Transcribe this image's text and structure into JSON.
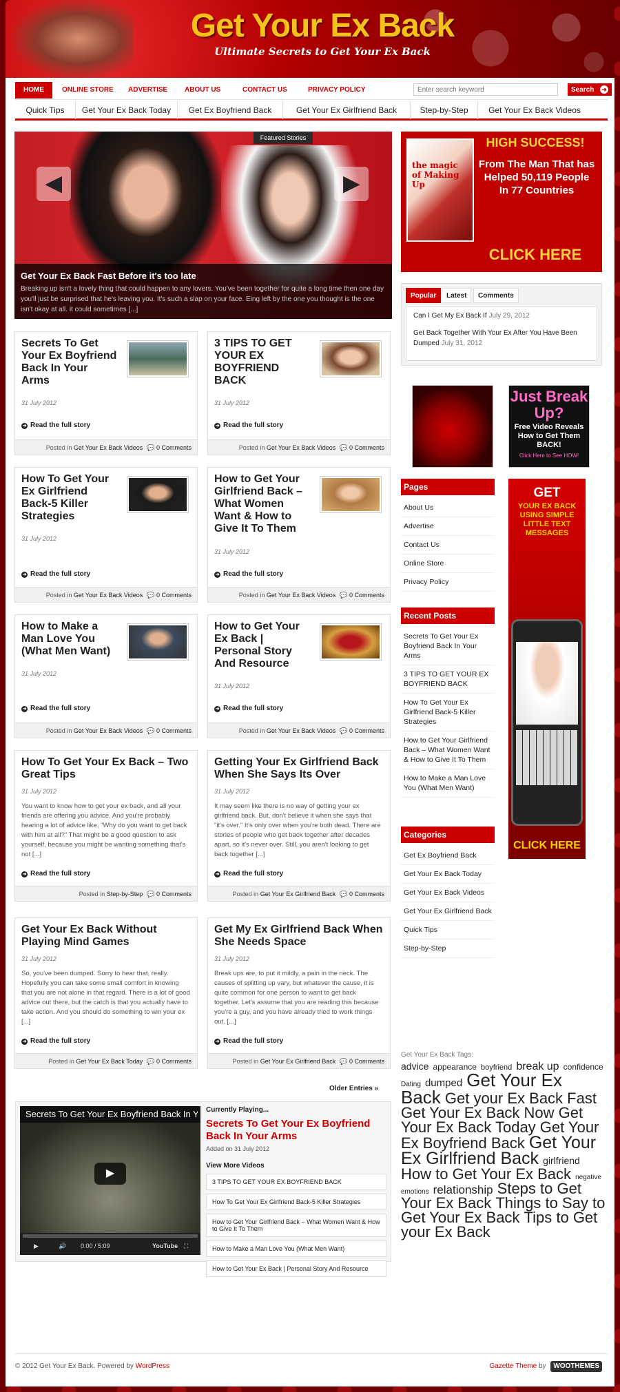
{
  "header": {
    "title": "Get Your Ex Back",
    "tagline": "Ultimate Secrets to Get Your Ex Back"
  },
  "topnav": {
    "items": [
      "HOME",
      "ONLINE STORE",
      "ADVERTISE",
      "ABOUT US",
      "CONTACT US",
      "PRIVACY POLICY"
    ],
    "search_placeholder": "Enter search keyword",
    "search_button": "Search"
  },
  "catnav": {
    "items": [
      "Quick Tips",
      "Get Your Ex Back Today",
      "Get Ex Boyfriend Back",
      "Get Your Ex Girlfriend Back",
      "Step-by-Step",
      "Get Your Ex Back Videos"
    ]
  },
  "featured": {
    "tag": "Featured Stories",
    "title": "Get Your Ex Back Fast Before it's too late",
    "excerpt": "Breaking up isn't a lovely thing that could happen to any lovers. You've been together for quite a long time then one day you'll just be surprised that he's leaving you. It's such a slap on your face. Eing left by the one you thought is the one isn't okay at all. it could sometimes [...]"
  },
  "posts": [
    {
      "title": "Secrets To Get Your Ex Boyfriend Back In Your Arms",
      "date": "31 July 2012",
      "excerpt": "",
      "more": "Read the full story",
      "posted_in": "Posted in",
      "category": "Get Your Ex Back Videos",
      "comments": "0 Comments"
    },
    {
      "title": "3 TIPS TO GET YOUR EX BOYFRIEND BACK",
      "date": "31 July 2012",
      "excerpt": "",
      "more": "Read the full story",
      "posted_in": "Posted in",
      "category": "Get Your Ex Back Videos",
      "comments": "0 Comments"
    },
    {
      "title": "How To Get Your Ex Girlfriend Back-5 Killer Strategies",
      "date": "31 July 2012",
      "excerpt": "",
      "more": "Read the full story",
      "posted_in": "Posted in",
      "category": "Get Your Ex Back Videos",
      "comments": "0 Comments"
    },
    {
      "title": "How to Get Your Girlfriend Back – What Women Want & How to Give It To Them",
      "date": "31 July 2012",
      "excerpt": "",
      "more": "Read the full story",
      "posted_in": "Posted in",
      "category": "Get Your Ex Back Videos",
      "comments": "0 Comments"
    },
    {
      "title": "How to Make a Man Love You (What Men Want)",
      "date": "31 July 2012",
      "excerpt": "",
      "more": "Read the full story",
      "posted_in": "Posted in",
      "category": "Get Your Ex Back Videos",
      "comments": "0 Comments"
    },
    {
      "title": "How to Get Your Ex Back | Personal Story And Resource",
      "date": "31 July 2012",
      "excerpt": "",
      "more": "Read the full story",
      "posted_in": "Posted in",
      "category": "Get Your Ex Back Videos",
      "comments": "0 Comments"
    },
    {
      "title": "How To Get Your Ex Back – Two Great Tips",
      "date": "31 July 2012",
      "excerpt": "You want to know how to get your ex back, and all your friends are offering you advice. And you're probably hearing a lot of advice like, \"Why do you want to get back with him at all?\" That might be a good question to ask yourself, because you might be wanting something that's not [...]",
      "more": "Read the full story",
      "posted_in": "Posted in",
      "category": "Step-by-Step",
      "comments": "0 Comments"
    },
    {
      "title": "Getting Your Ex Girlfriend Back When She Says Its Over",
      "date": "31 July 2012",
      "excerpt": "It may seem like there is no way of getting your ex girlfriend back.  But, don't believe it when she says that \"it's over.\"  It's only over when you're both dead.  There are stories of people who get back together after decades apart, so it's never over. Still, you aren't looking to get back together [...]",
      "more": "Read the full story",
      "posted_in": "Posted in",
      "category": "Get Your Ex Girlfriend Back",
      "comments": "0 Comments"
    },
    {
      "title": "Get Your Ex Back Without Playing Mind Games",
      "date": "31 July 2012",
      "excerpt": "So, you've been dumped. Sorry to hear that, really. Hopefully you can take some small comfort in knowing that you are not alone in that regard. There is a lot of good advice out there, but the catch is that you actually have to take action. And you should do something to win your ex [...]",
      "more": "Read the full story",
      "posted_in": "Posted in",
      "category": "Get Your Ex Back Today",
      "comments": "0 Comments"
    },
    {
      "title": "Get My Ex Girlfriend Back When She Needs Space",
      "date": "31 July 2012",
      "excerpt": "Break ups are, to put it mildly, a pain in the neck. The causes of splitting up vary, but whatever the cause, it is quite common for one person to want to get back together. Let's assume that you are reading this because you're a guy, and you have already tried to work things out. [...]",
      "more": "Read the full story",
      "posted_in": "Posted in",
      "category": "Get Your Ex Girlfriend Back",
      "comments": "0 Comments"
    }
  ],
  "older_entries": "Older Entries »",
  "video": {
    "player_title": "Secrets To Get Your Ex Boyfriend Back In Your Arms",
    "time": "0:00 / 5:09",
    "brand": "YouTube",
    "currently_label": "Currently Playing...",
    "current_title": "Secrets To Get Your Ex Boyfriend Back In Your Arms",
    "added": "Added on 31 July 2012",
    "view_more_label": "View More Videos",
    "links": [
      "3 TIPS TO GET YOUR EX BOYFRIEND BACK",
      "How To Get Your Ex Girlfriend Back-5 Killer Strategies",
      "How to Get Your Girlfriend Back – What Women Want & How to Give It To Them",
      "How to Make a Man Love You (What Men Want)",
      "How to Get Your Ex Back | Personal Story And Resource"
    ]
  },
  "footer": {
    "copyright": "© 2012 Get Your Ex Back. Powered by",
    "powered_link": "WordPress",
    "theme_link": "Gazette Theme",
    "by": "by",
    "woo": "WOOTHEMES"
  },
  "sidebar": {
    "ad_top": {
      "headline": "HIGH SUCCESS!",
      "body": "From The Man That has Helped 50,119 People In 77 Countries",
      "cta": "CLICK HERE",
      "book_title": "the magic of Making Up"
    },
    "tabs": [
      "Popular",
      "Latest",
      "Comments"
    ],
    "popular": [
      {
        "title": "Can I Get My Ex Back If",
        "date": "July 29, 2012"
      },
      {
        "title": "Get Back Together With Your Ex After You Have Been Dumped",
        "date": "July 31, 2012"
      }
    ],
    "ad_small_2": {
      "line1": "Just Break Up?",
      "line2": "Free Video Reveals How to Get Them BACK!",
      "line3": "Click Here to See HOW!"
    },
    "pages_title": "Pages",
    "pages": [
      "About Us",
      "Advertise",
      "Contact Us",
      "Online Store",
      "Privacy Policy"
    ],
    "recent_title": "Recent Posts",
    "recent": [
      "Secrets To Get Your Ex Boyfriend Back In Your Arms",
      "3 TIPS TO GET YOUR EX BOYFRIEND BACK",
      "How To Get Your Ex Girlfriend Back-5 Killer Strategies",
      "How to Get Your Girlfriend Back – What Women Want & How to Give It To Them",
      "How to Make a Man Love You (What Men Want)"
    ],
    "categories_title": "Categories",
    "categories": [
      "Get Ex Boyfriend Back",
      "Get Your Ex Back Today",
      "Get Your Ex Back Videos",
      "Get Your Ex Girlfriend Back",
      "Quick Tips",
      "Step-by-Step"
    ],
    "skyscraper": {
      "l1": "GET",
      "l2": "YOUR EX BACK USING SIMPLE LITTLE TEXT MESSAGES",
      "cta": "CLICK HERE"
    },
    "tags_label": "Get Your Ex Back Tags:",
    "tags": [
      {
        "t": "advice",
        "s": 14
      },
      {
        "t": "appearance",
        "s": 12
      },
      {
        "t": "boyfriend",
        "s": 11
      },
      {
        "t": "break up",
        "s": 16
      },
      {
        "t": "confidence",
        "s": 12
      },
      {
        "t": "Dating",
        "s": 10
      },
      {
        "t": "dumped",
        "s": 15
      },
      {
        "t": "Get Your Ex Back",
        "s": 26
      },
      {
        "t": "Get your Ex Back Fast",
        "s": 22
      },
      {
        "t": "Get Your Ex Back Now",
        "s": 22
      },
      {
        "t": "Get Your Ex Back Today",
        "s": 22
      },
      {
        "t": "Get Your Ex Boyfriend Back",
        "s": 22
      },
      {
        "t": "Get Your Ex Girlfriend Back",
        "s": 25
      },
      {
        "t": "girlfriend",
        "s": 14
      },
      {
        "t": "How to Get Your Ex Back",
        "s": 22
      },
      {
        "t": "negative emotions",
        "s": 10
      },
      {
        "t": "relationship",
        "s": 17
      },
      {
        "t": "Steps to Get Your Ex Back",
        "s": 22
      },
      {
        "t": "Things to Say to Get Your Ex Back",
        "s": 22
      },
      {
        "t": "Tips to Get your Ex Back",
        "s": 22
      }
    ]
  },
  "colors": {
    "accent": "#cc0000",
    "title_gold": "#f5c21b"
  }
}
